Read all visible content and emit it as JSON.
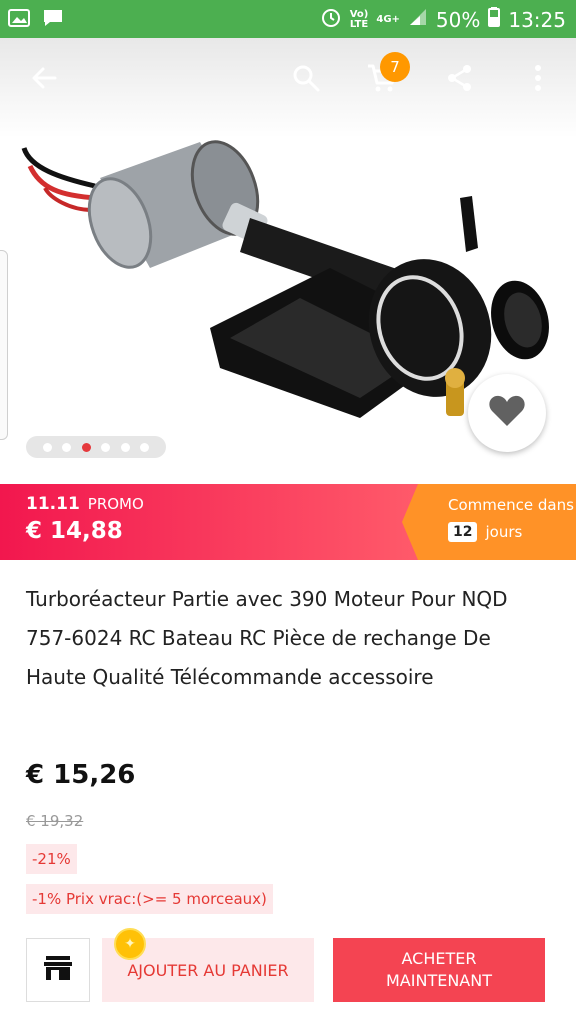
{
  "status_bar": {
    "network_top": "Vo)",
    "network_bottom": "LTE",
    "signal_label": "4G+",
    "battery": "50%",
    "time": "13:25"
  },
  "toolbar": {
    "cart_count": "7"
  },
  "gallery": {
    "image_count": 6,
    "active_index": 2
  },
  "promo": {
    "event": "11.11",
    "event_label": "PROMO",
    "price": "€ 14,88",
    "countdown_label": "Commence dans",
    "countdown_value": "12",
    "countdown_unit": "jours"
  },
  "product": {
    "title": "Turboréacteur Partie avec 390 Moteur Pour NQD 757-6024 RC Bateau RC Pièce de rechange De Haute Qualité Télécommande accessoire",
    "price": "€ 15,26",
    "old_price": "€ 19,32",
    "discount": "-21%",
    "bulk": "-1% Prix vrac:(>= 5 morceaux)"
  },
  "actions": {
    "add_to_cart": "AJOUTER AU PANIER",
    "buy_now": "ACHETER MAINTENANT"
  },
  "colors": {
    "status_bar": "#4caf50",
    "promo_pink": "#f2174e",
    "promo_orange": "#ff9227",
    "accent_red": "#e53935",
    "buy_button": "#f44452"
  }
}
